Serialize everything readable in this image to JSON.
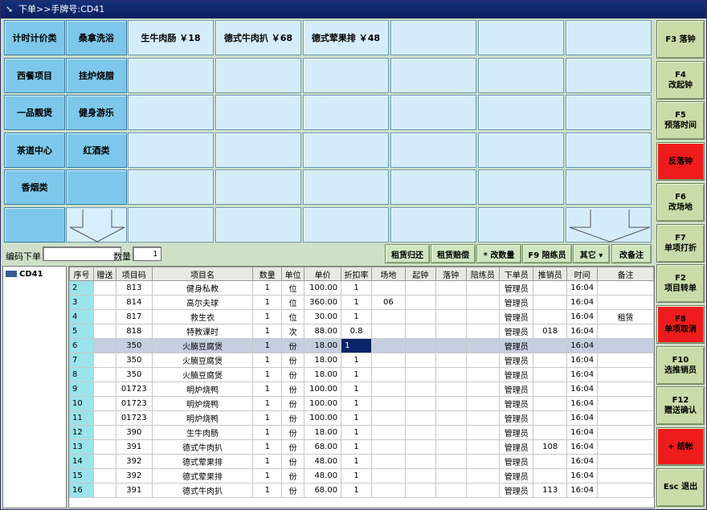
{
  "window": {
    "title": "下单>>手牌号:CD41"
  },
  "categories": [
    [
      "计时计价类",
      "桑拿洗浴"
    ],
    [
      "西餐项目",
      "挂炉烧腊"
    ],
    [
      "一品靓煲",
      "健身游乐"
    ],
    [
      "茶道中心",
      "红酒类"
    ],
    [
      "香烟类",
      ""
    ]
  ],
  "items": [
    "生牛肉肠 ￥18",
    "德式牛肉扒 ￥68",
    "德式荤果排 ￥48",
    "",
    "",
    "",
    ""
  ],
  "fkeys": [
    {
      "line1": "F3 落钟",
      "line2": "",
      "color": "green"
    },
    {
      "line1": "F4",
      "line2": "改起钟",
      "color": "green"
    },
    {
      "line1": "F5",
      "line2": "预落时间",
      "color": "green"
    },
    {
      "line1": "反落钟",
      "line2": "",
      "color": "red"
    },
    {
      "line1": "F6",
      "line2": "改场地",
      "color": "green"
    },
    {
      "line1": "F7",
      "line2": "单项打折",
      "color": "green"
    },
    {
      "line1": "F2",
      "line2": "项目转单",
      "color": "green"
    },
    {
      "line1": "F8",
      "line2": "单项取消",
      "color": "red"
    },
    {
      "line1": "F10",
      "line2": "选推销员",
      "color": "green"
    },
    {
      "line1": "F12",
      "line2": "赠送确认",
      "color": "green"
    },
    {
      "line1": "+ 结帐",
      "line2": "",
      "color": "red"
    },
    {
      "line1": "Esc 退出",
      "line2": "",
      "color": "green"
    }
  ],
  "toolbar": {
    "code_label": "编码下单",
    "code_value": "",
    "qty_label": "数量",
    "qty_value": "1",
    "btn_rent_return": "租赁归还",
    "btn_rent_comp": "租赁赔偿",
    "btn_change_qty": "* 改数量",
    "btn_trainer": "F9 陪练员",
    "btn_other": "其它 ▾",
    "btn_remark": "改备注"
  },
  "tree": {
    "node": "CD41"
  },
  "table": {
    "headers": [
      "序号",
      "赠送",
      "项目码",
      "项目名",
      "数量",
      "单位",
      "单价",
      "折扣率",
      "场地",
      "起钟",
      "落钟",
      "陪练员",
      "下单员",
      "推销员",
      "时间",
      "备注"
    ],
    "rows": [
      [
        "2",
        "",
        "813",
        "健身私教",
        "1",
        "位",
        "100.00",
        "1",
        "",
        "",
        "",
        "",
        "管理员",
        "",
        "16:04",
        ""
      ],
      [
        "3",
        "",
        "814",
        "高尔夫球",
        "1",
        "位",
        "360.00",
        "1",
        "06",
        "",
        "",
        "",
        "管理员",
        "",
        "16:04",
        ""
      ],
      [
        "4",
        "",
        "817",
        "救生衣",
        "1",
        "位",
        "30.00",
        "1",
        "",
        "",
        "",
        "",
        "管理员",
        "",
        "16:04",
        "租赁"
      ],
      [
        "5",
        "",
        "818",
        "特教课时",
        "1",
        "次",
        "88.00",
        "0.8",
        "",
        "",
        "",
        "",
        "管理员",
        "018",
        "16:04",
        ""
      ],
      [
        "6",
        "",
        "350",
        "火腩豆腐煲",
        "1",
        "份",
        "18.00",
        "1",
        "",
        "",
        "",
        "",
        "管理员",
        "",
        "16:04",
        ""
      ],
      [
        "7",
        "",
        "350",
        "火腩豆腐煲",
        "1",
        "份",
        "18.00",
        "1",
        "",
        "",
        "",
        "",
        "管理员",
        "",
        "16:04",
        ""
      ],
      [
        "8",
        "",
        "350",
        "火腩豆腐煲",
        "1",
        "份",
        "18.00",
        "1",
        "",
        "",
        "",
        "",
        "管理员",
        "",
        "16:04",
        ""
      ],
      [
        "9",
        "",
        "01723",
        "明炉烧鸭",
        "1",
        "份",
        "100.00",
        "1",
        "",
        "",
        "",
        "",
        "管理员",
        "",
        "16:04",
        ""
      ],
      [
        "10",
        "",
        "01723",
        "明炉烧鸭",
        "1",
        "份",
        "100.00",
        "1",
        "",
        "",
        "",
        "",
        "管理员",
        "",
        "16:04",
        ""
      ],
      [
        "11",
        "",
        "01723",
        "明炉烧鸭",
        "1",
        "份",
        "100.00",
        "1",
        "",
        "",
        "",
        "",
        "管理员",
        "",
        "16:04",
        ""
      ],
      [
        "12",
        "",
        "390",
        "生牛肉肠",
        "1",
        "份",
        "18.00",
        "1",
        "",
        "",
        "",
        "",
        "管理员",
        "",
        "16:04",
        ""
      ],
      [
        "13",
        "",
        "391",
        "德式牛肉扒",
        "1",
        "份",
        "68.00",
        "1",
        "",
        "",
        "",
        "",
        "管理员",
        "108",
        "16:04",
        ""
      ],
      [
        "14",
        "",
        "392",
        "德式荤果排",
        "1",
        "份",
        "48.00",
        "1",
        "",
        "",
        "",
        "",
        "管理员",
        "",
        "16:04",
        ""
      ],
      [
        "15",
        "",
        "392",
        "德式荤果排",
        "1",
        "份",
        "48.00",
        "1",
        "",
        "",
        "",
        "",
        "管理员",
        "",
        "16:04",
        ""
      ],
      [
        "16",
        "",
        "391",
        "德式牛肉扒",
        "1",
        "份",
        "68.00",
        "1",
        "",
        "",
        "",
        "",
        "管理员",
        "113",
        "16:04",
        ""
      ]
    ],
    "selected_row": 4,
    "focus_col": 7
  },
  "colors": {
    "title": "#0c1f5e",
    "category": "#7dc8ea",
    "item": "#d5edfb",
    "fkey": "#c9dba8",
    "fkey_red": "#ee1c1c",
    "selected_cell": "#0a246a",
    "seq_col": "#9be3ea"
  },
  "icons": {
    "title": "arrow-icon",
    "tree": "key-icon",
    "scroll": "down-arrow-icon"
  }
}
